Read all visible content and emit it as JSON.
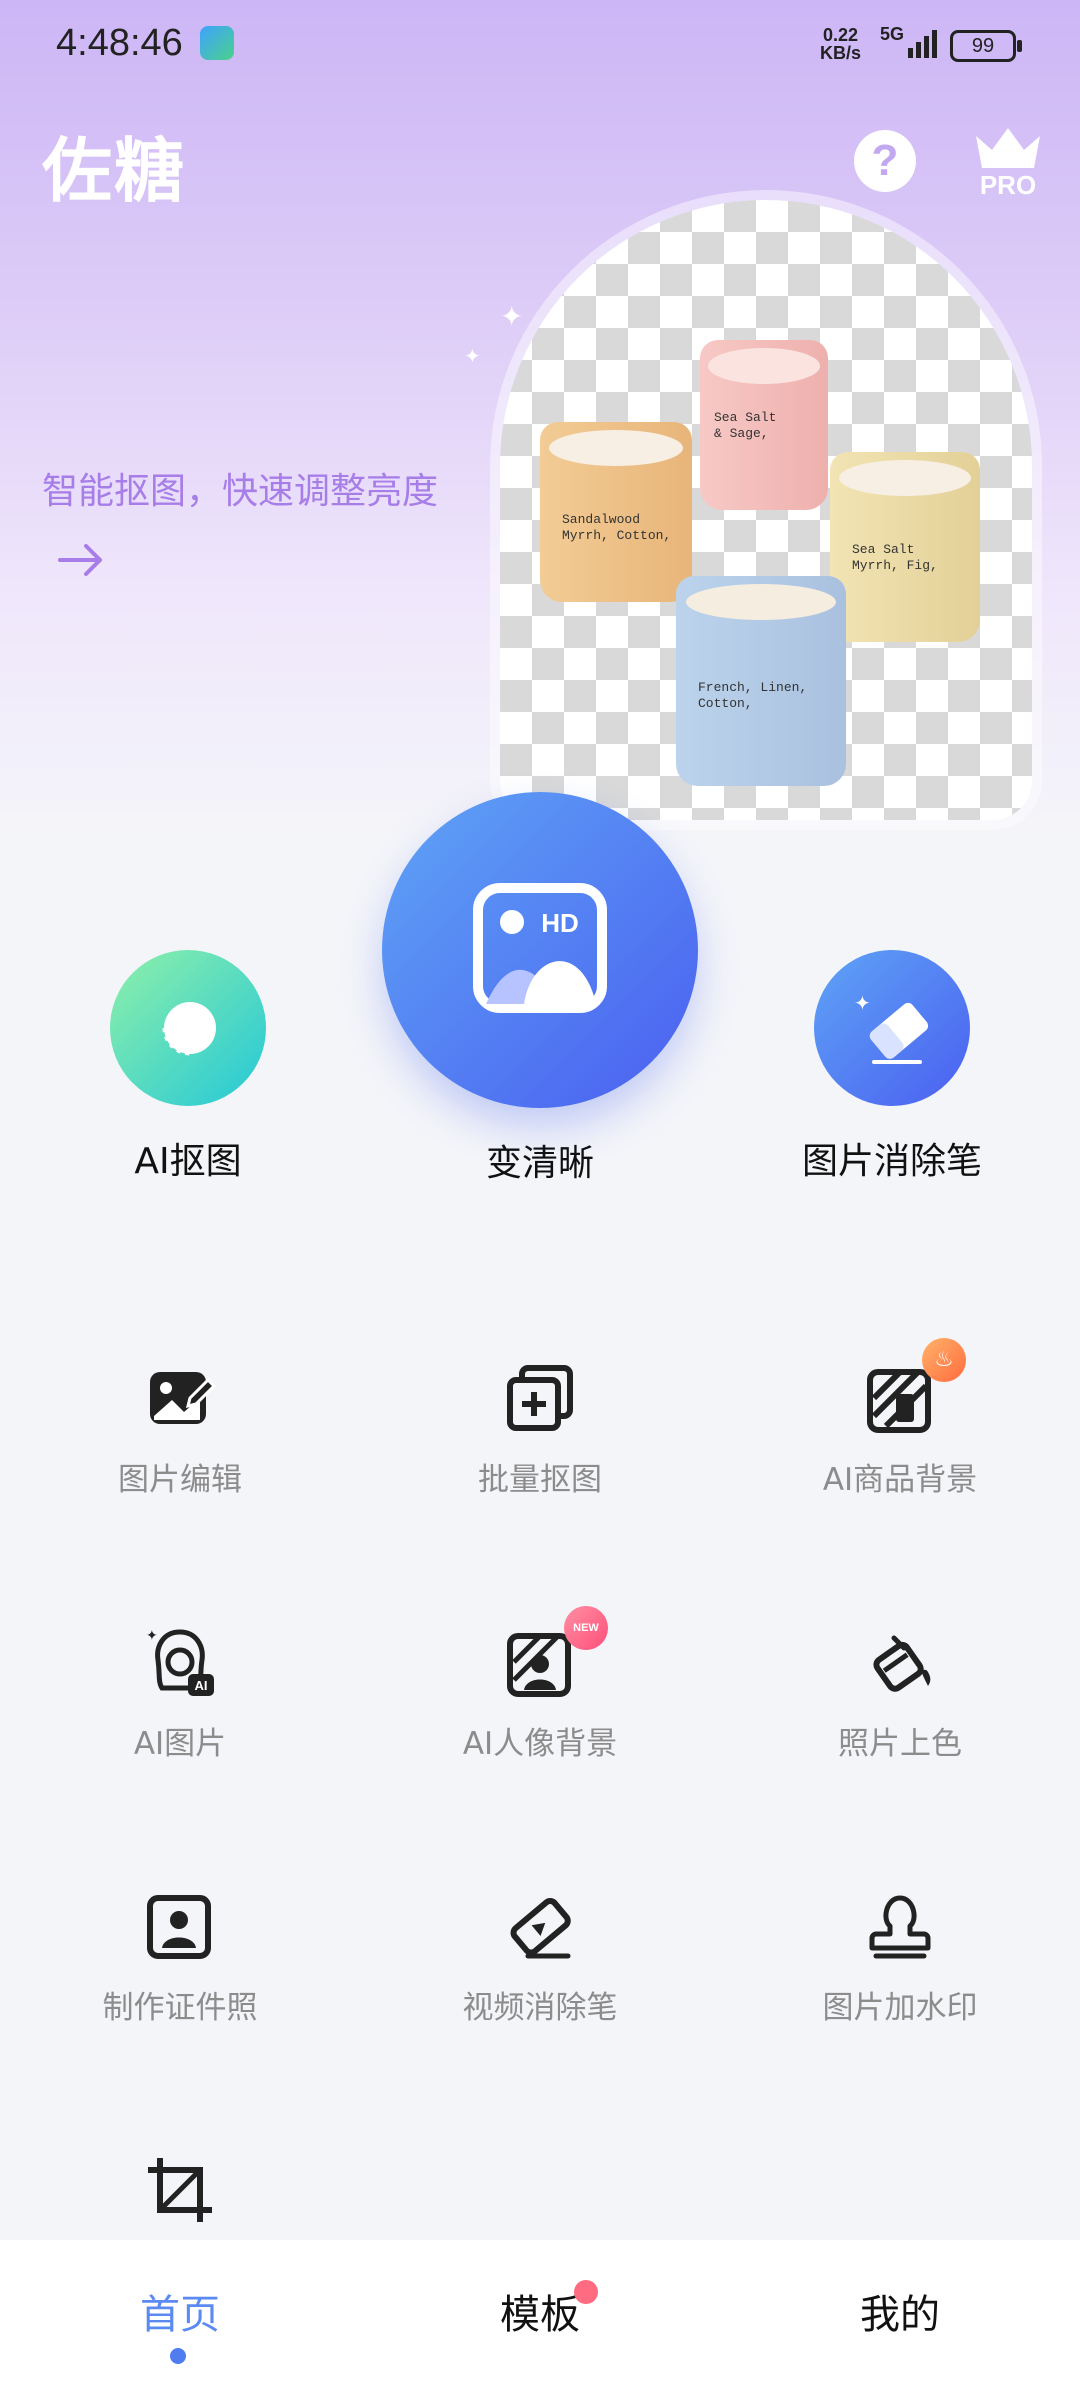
{
  "status_bar": {
    "time": "4:48:46",
    "net_speed_value": "0.22",
    "net_speed_unit": "KB/s",
    "network": "5G",
    "battery": "99"
  },
  "header": {
    "brand": "佐糖",
    "help_icon": "question-icon",
    "pro_label": "PRO"
  },
  "banner": {
    "text": "智能抠图，快速调整亮度",
    "candles": [
      {
        "label": "Sandalwood\nMyrrh, Cotton,"
      },
      {
        "label": "Sea Salt\n& Sage,"
      },
      {
        "label": "Sea Salt\nMyrrh, Fig,"
      },
      {
        "label": "French, Linen,\nCotton,"
      }
    ]
  },
  "main_tools": [
    {
      "label": "AI抠图",
      "icon": "ai-cutout-icon"
    },
    {
      "label": "变清晰",
      "icon": "hd-image-icon",
      "badge": "HD"
    },
    {
      "label": "图片消除笔",
      "icon": "eraser-icon"
    }
  ],
  "tools": [
    {
      "label": "图片编辑",
      "icon": "image-edit-icon"
    },
    {
      "label": "批量抠图",
      "icon": "batch-cutout-icon"
    },
    {
      "label": "AI商品背景",
      "icon": "product-background-icon"
    },
    {
      "label": "AI图片",
      "icon": "ai-image-icon"
    },
    {
      "label": "AI人像背景",
      "icon": "portrait-background-icon",
      "badge": "NEW"
    },
    {
      "label": "照片上色",
      "icon": "paint-bucket-icon"
    },
    {
      "label": "制作证件照",
      "icon": "id-photo-icon"
    },
    {
      "label": "视频消除笔",
      "icon": "video-eraser-icon"
    },
    {
      "label": "图片加水印",
      "icon": "stamp-icon"
    },
    {
      "label": "",
      "icon": "crop-icon"
    }
  ],
  "nav": {
    "home": "首页",
    "templates": "模板",
    "mine": "我的"
  },
  "colors": {
    "accent": "#5b8af2",
    "banner_text": "#a77de8",
    "header_bg": "#cdb6f6"
  }
}
